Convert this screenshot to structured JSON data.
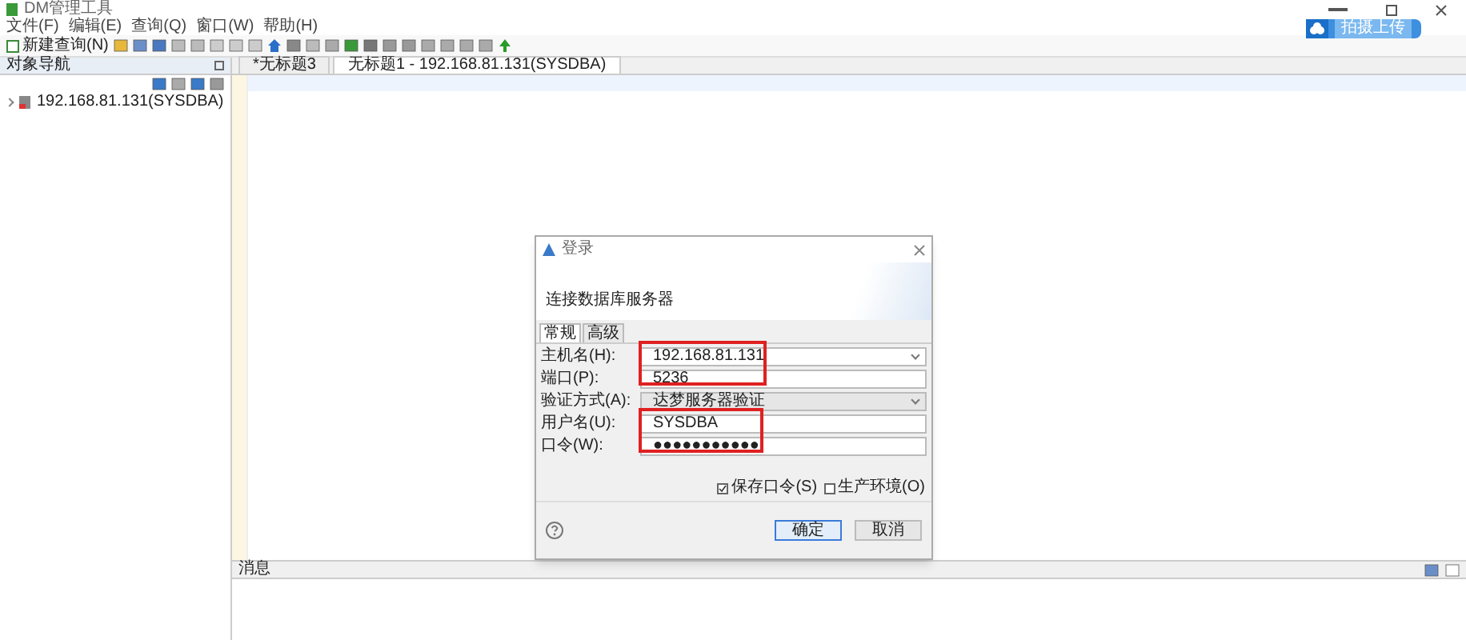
{
  "window": {
    "title": "DM管理工具"
  },
  "menu": [
    "文件(F)",
    "编辑(E)",
    "查询(Q)",
    "窗口(W)",
    "帮助(H)"
  ],
  "toolbar": {
    "new_query": "新建查询(N)"
  },
  "upload_button": "拍摄上传",
  "navigator": {
    "title": "对象导航",
    "tree": [
      {
        "label": "192.168.81.131(SYSDBA)",
        "expanded": false
      }
    ]
  },
  "editor_tabs": [
    {
      "label": "*无标题3",
      "selected": false
    },
    {
      "label": "无标题1 - 192.168.81.131(SYSDBA)",
      "selected": true
    }
  ],
  "messages": {
    "title": "消息"
  },
  "dialog": {
    "title": "登录",
    "header": "连接数据库服务器",
    "tabs": [
      {
        "label": "常规",
        "selected": true
      },
      {
        "label": "高级",
        "selected": false
      }
    ],
    "fields": [
      {
        "label": "主机名(H):",
        "value": "192.168.81.131",
        "kind": "combo"
      },
      {
        "label": "端口(P):",
        "value": "5236",
        "kind": "text"
      },
      {
        "label": "验证方式(A):",
        "value": "达梦服务器验证",
        "kind": "select"
      },
      {
        "label": "用户名(U):",
        "value": "SYSDBA",
        "kind": "text"
      },
      {
        "label": "口令(W):",
        "value": "●●●●●●●●●●●",
        "kind": "text"
      }
    ],
    "checkboxes": [
      {
        "label": "保存口令(S)",
        "checked": true
      },
      {
        "label": "生产环境(O)",
        "checked": false
      }
    ],
    "buttons": [
      {
        "label": "确定",
        "kind": "primary"
      },
      {
        "label": "取消",
        "kind": "normal"
      }
    ]
  }
}
